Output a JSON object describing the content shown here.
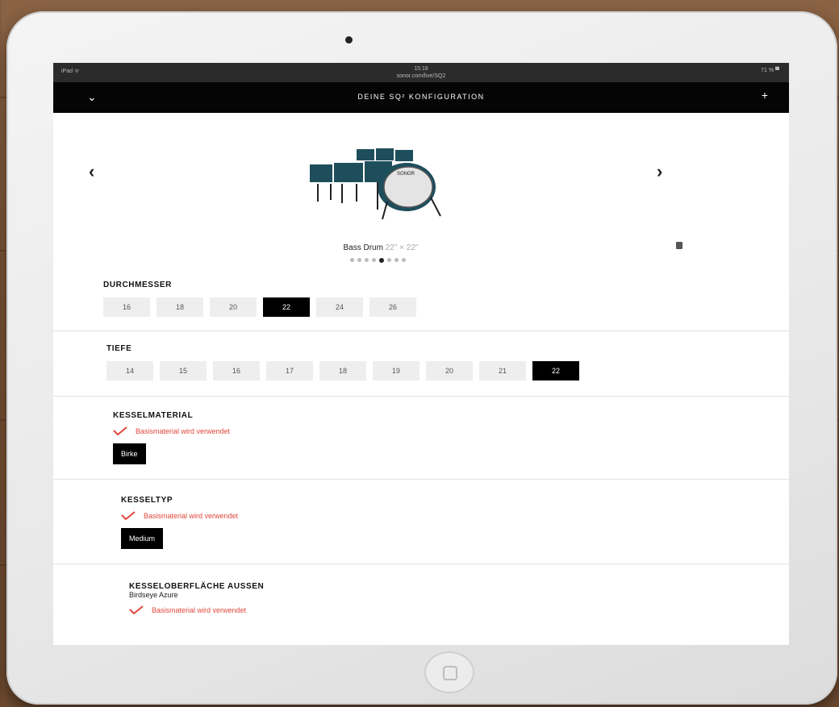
{
  "status_bar": {
    "left": "iPad ᯤ",
    "time": "15:18",
    "url": "sonor.com/live/SQ2",
    "right": "71 % ▀"
  },
  "header": {
    "title": "DEINE SQ² KONFIGURATION",
    "collapse_icon": "chevron-down-icon",
    "add_icon": "plus-icon"
  },
  "viewer": {
    "prev_label": "‹",
    "next_label": "›",
    "caption_main": "Bass Drum",
    "caption_size": "22\" × 22\"",
    "dot_count": 8,
    "active_dot": 4
  },
  "durchmesser": {
    "label": "DURCHMESSER",
    "options": [
      "16",
      "18",
      "20",
      "22",
      "24",
      "26"
    ],
    "selected": "22"
  },
  "tiefe": {
    "label": "TIEFE",
    "options": [
      "14",
      "15",
      "16",
      "17",
      "18",
      "19",
      "20",
      "21",
      "22"
    ],
    "selected": "22"
  },
  "kesselmaterial": {
    "label": "KESSELMATERIAL",
    "notice": "Basismaterial wird verwendet",
    "value": "Birke"
  },
  "kesseltyp": {
    "label": "KESSELTYP",
    "notice": "Basismaterial wird verwendet",
    "value": "Medium"
  },
  "kesseloberflaeche": {
    "label": "KESSELOBERFLÄCHE AUSSEN",
    "sub": "Birdseye Azure",
    "notice": "Basismaterial wird verwendet"
  },
  "colors": {
    "accent_red": "#e0473a",
    "header_bg": "#050505",
    "drum_teal": "#1e4e5c"
  }
}
